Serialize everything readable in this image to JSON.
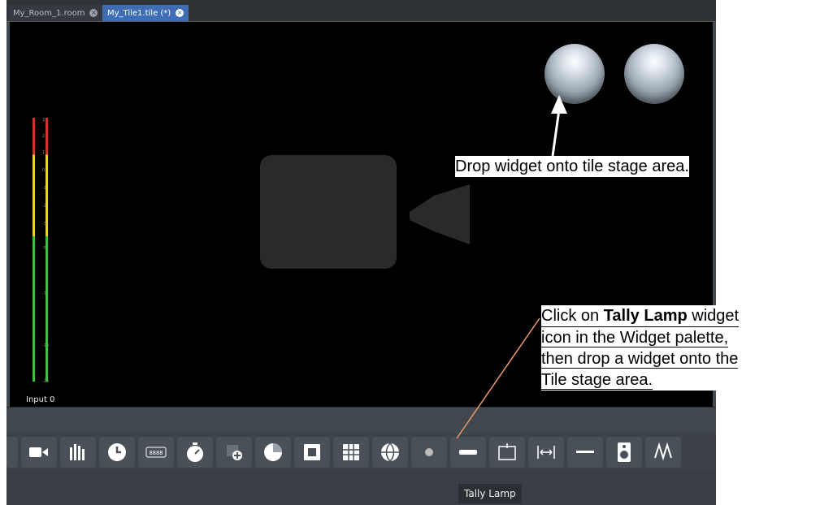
{
  "tabs": [
    {
      "label": "My_Room_1.room",
      "close": "×"
    },
    {
      "label": "My_Tile1.tile (*)",
      "close": "×"
    }
  ],
  "meter": {
    "ticks": [
      "3",
      "2",
      "1",
      "0",
      "-1",
      "-2",
      "-3",
      "-5",
      "-7",
      "-14",
      "-20"
    ],
    "label": "Input 0"
  },
  "palette": {
    "items": [
      "bars-icon",
      "camera-icon",
      "audio-meter-icon",
      "clock-icon",
      "counter-icon",
      "timer-icon",
      "layers-add-icon",
      "pie-chart-icon",
      "chart-icon",
      "grid-icon",
      "globe-icon",
      "tally-lamp-icon",
      "slider-icon",
      "label-icon",
      "arrows-horizontal-icon",
      "line-icon",
      "speaker-icon",
      "waveform-icon"
    ]
  },
  "tooltip": "Tally Lamp",
  "annotations": {
    "drop": "Drop widget onto tile stage area.",
    "click_pre": "Click on ",
    "click_bold": "Tally Lamp",
    "click_post": " widget",
    "line2": "icon in the Widget palette,",
    "line3": "then drop a widget onto the",
    "line4": "Tile stage area."
  },
  "colors": {
    "accent": "#3f6db5",
    "arrow": "#ffffff",
    "leader": "#e89a6a"
  }
}
